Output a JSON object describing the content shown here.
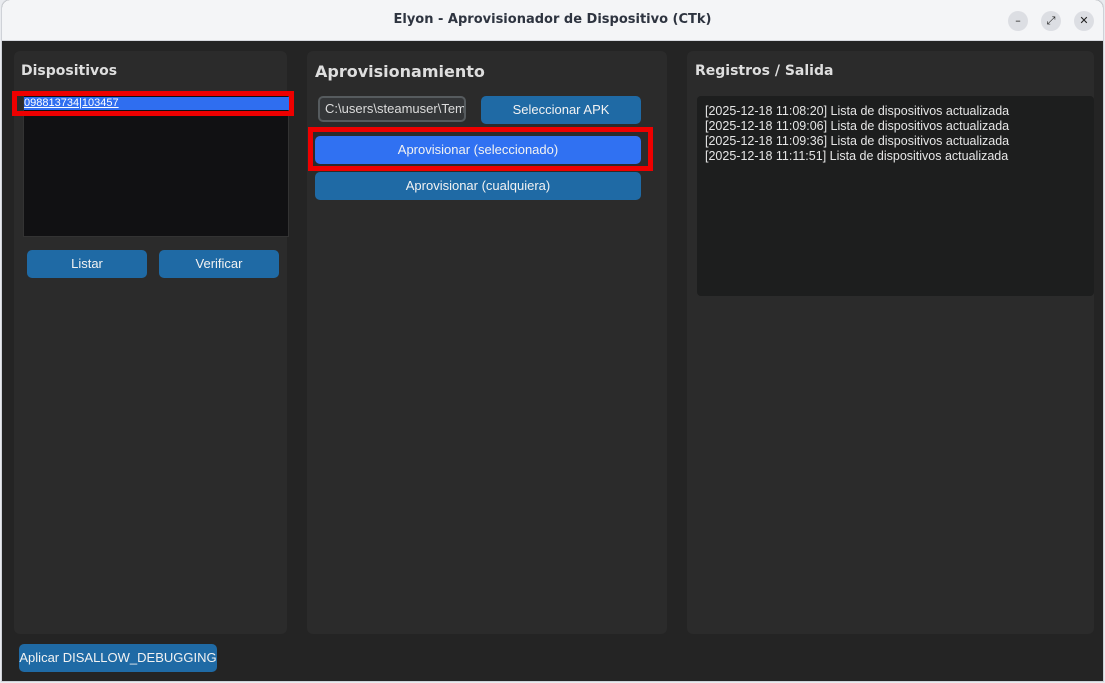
{
  "window": {
    "title": "Elyon - Aprovisionador de Dispositivo (CTk)",
    "minimize_icon": "minimize-icon",
    "maximize_icon": "maximize-icon",
    "close_icon": "close-icon"
  },
  "devices": {
    "title": "Dispositivos",
    "items": [
      "098813734|103457"
    ],
    "list_button": "Listar",
    "verify_button": "Verificar"
  },
  "provisioning": {
    "title": "Aprovisionamiento",
    "apk_path_value": "C:\\users\\steamuser\\Temp",
    "select_apk_button": "Seleccionar APK",
    "provision_selected_button": "Aprovisionar (seleccionado)",
    "provision_any_button": "Aprovisionar (cualquiera)"
  },
  "logs": {
    "title": "Registros / Salida",
    "lines": [
      "[2025-12-18 11:08:20] Lista de dispositivos actualizada",
      "[2025-12-18 11:09:06] Lista de dispositivos actualizada",
      "[2025-12-18 11:09:36] Lista de dispositivos actualizada",
      "[2025-12-18 11:11:51] Lista de dispositivos actualizada"
    ]
  },
  "footer": {
    "disallow_debugging_button": "Aplicar DISALLOW_DEBUGGING"
  },
  "colors": {
    "accent_button": "#1f6aa5",
    "selected_button": "#3071f2",
    "highlight": "#ee0000"
  }
}
